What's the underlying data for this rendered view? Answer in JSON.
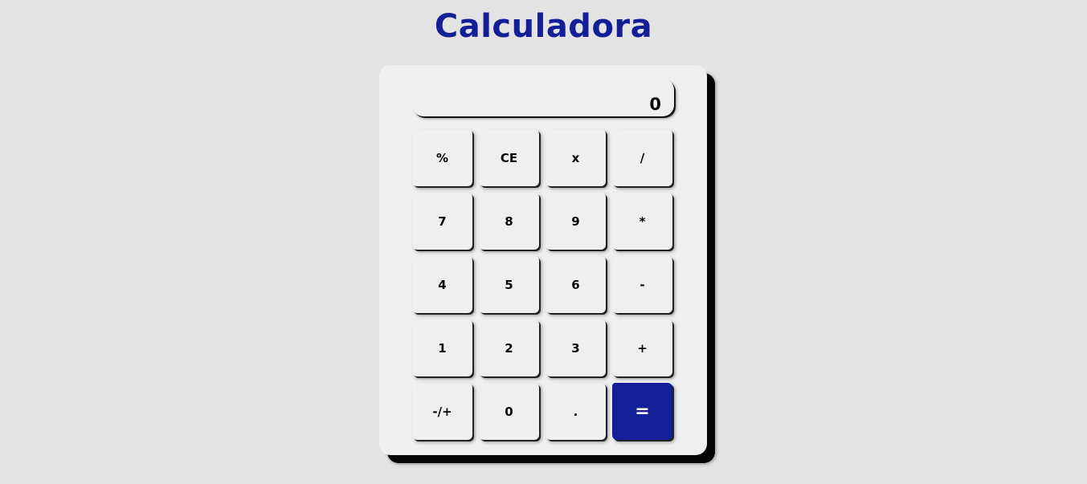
{
  "page": {
    "title": "Calculadora"
  },
  "colors": {
    "background": "#e3e3e3",
    "title": "#121f97",
    "panel": "#efefef",
    "accent": "#121f97"
  },
  "display": {
    "value": "0"
  },
  "keys": [
    {
      "label": "%",
      "name": "percent-key"
    },
    {
      "label": "CE",
      "name": "clear-entry-key"
    },
    {
      "label": "x",
      "name": "x-key"
    },
    {
      "label": "/",
      "name": "divide-key"
    },
    {
      "label": "7",
      "name": "digit-7-key"
    },
    {
      "label": "8",
      "name": "digit-8-key"
    },
    {
      "label": "9",
      "name": "digit-9-key"
    },
    {
      "label": "*",
      "name": "multiply-key"
    },
    {
      "label": "4",
      "name": "digit-4-key"
    },
    {
      "label": "5",
      "name": "digit-5-key"
    },
    {
      "label": "6",
      "name": "digit-6-key"
    },
    {
      "label": "-",
      "name": "subtract-key"
    },
    {
      "label": "1",
      "name": "digit-1-key"
    },
    {
      "label": "2",
      "name": "digit-2-key"
    },
    {
      "label": "3",
      "name": "digit-3-key"
    },
    {
      "label": "+",
      "name": "add-key"
    },
    {
      "label": "-/+",
      "name": "toggle-sign-key"
    },
    {
      "label": "0",
      "name": "digit-0-key"
    },
    {
      "label": ".",
      "name": "decimal-key"
    },
    {
      "label": "=",
      "name": "equals-key"
    }
  ]
}
